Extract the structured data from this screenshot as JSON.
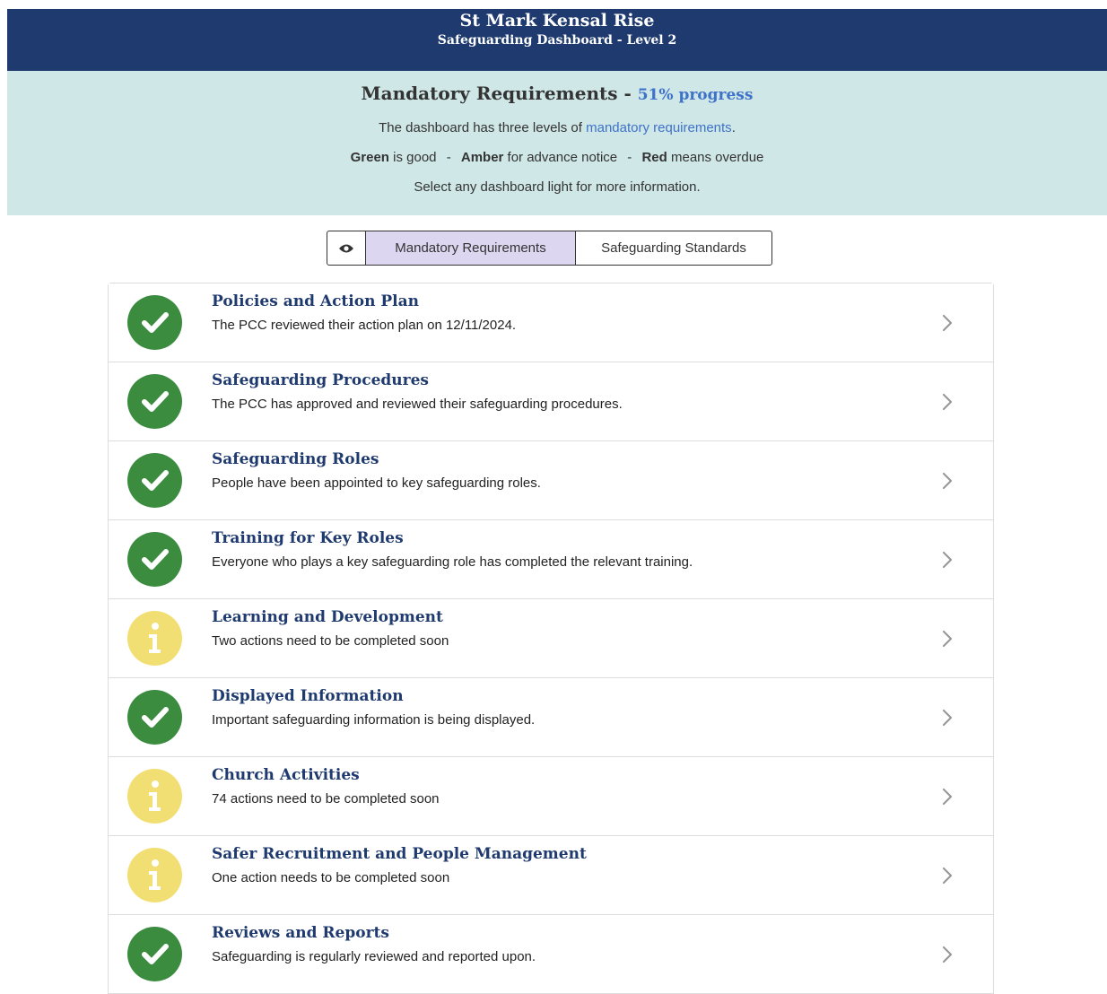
{
  "header": {
    "site_name": "St Mark Kensal Rise",
    "subtitle": "Safeguarding Dashboard - Level 2",
    "bg_color": "#1f3a6e"
  },
  "intro": {
    "heading": "Mandatory Requirements -",
    "progress": "51% progress",
    "line1_pre": "The dashboard has three levels of",
    "line1_link": "mandatory requirements",
    "line1_post": ".",
    "legend": {
      "green": "Green",
      "green_text": "is good",
      "amber": "Amber",
      "amber_text": "for advance notice",
      "red": "Red",
      "red_text": "means overdue",
      "separator": "-"
    },
    "line3": "Select any dashboard light for more information.",
    "bg_color": "#cfe7e6"
  },
  "tabs": {
    "toggle_icon": "eye-icon",
    "active_label": "Mandatory Requirements",
    "inactive_label": "Safeguarding Standards"
  },
  "colors": {
    "green": "#3b8c3f",
    "amber": "#f2df73",
    "title": "#1f3a6e",
    "link": "#3f72c9"
  },
  "items": [
    {
      "title": "Policies and Action Plan",
      "desc": "The PCC reviewed their action plan on 12/11/2024.",
      "status": "green",
      "icon": "check-icon"
    },
    {
      "title": "Safeguarding Procedures",
      "desc": "The PCC has approved and reviewed their safeguarding procedures.",
      "status": "green",
      "icon": "check-icon"
    },
    {
      "title": "Safeguarding Roles",
      "desc": "People have been appointed to key safeguarding roles.",
      "status": "green",
      "icon": "check-icon"
    },
    {
      "title": "Training for Key Roles",
      "desc": "Everyone who plays a key safeguarding role has completed the relevant training.",
      "status": "green",
      "icon": "check-icon"
    },
    {
      "title": "Learning and Development",
      "desc": "Two actions need to be completed soon",
      "status": "amber",
      "icon": "info-icon"
    },
    {
      "title": "Displayed Information",
      "desc": "Important safeguarding information is being displayed.",
      "status": "green",
      "icon": "check-icon"
    },
    {
      "title": "Church Activities",
      "desc": "74 actions need to be completed soon",
      "status": "amber",
      "icon": "info-icon"
    },
    {
      "title": "Safer Recruitment and People Management",
      "desc": "One action needs to be completed soon",
      "status": "amber",
      "icon": "info-icon"
    },
    {
      "title": "Reviews and Reports",
      "desc": "Safeguarding is regularly reviewed and reported upon.",
      "status": "green",
      "icon": "check-icon"
    }
  ]
}
